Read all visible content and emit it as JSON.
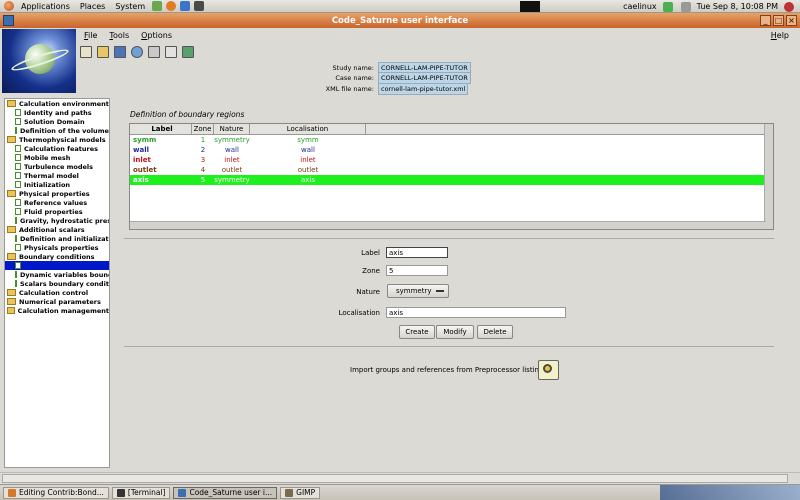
{
  "desktop": {
    "menus": [
      "Applications",
      "Places",
      "System"
    ],
    "user": "caelinux",
    "clock": "Tue Sep  8, 10:08 PM"
  },
  "window": {
    "title": "Code_Saturne user interface",
    "menus": [
      "File",
      "Tools",
      "Options"
    ],
    "help": "Help"
  },
  "study": {
    "study_label": "Study name:",
    "study_value": "CORNELL-LAM-PIPE-TUTOR",
    "case_label": "Case name:",
    "case_value": "CORNELL-LAM-PIPE-TUTOR",
    "xml_label": "XML file name:",
    "xml_value": "cornell-lam-pipe-tutor.xml"
  },
  "tree": [
    {
      "label": "Calculation environment",
      "level": 0,
      "type": "folder"
    },
    {
      "label": "Identity and paths",
      "level": 1,
      "type": "doc"
    },
    {
      "label": "Solution Domain",
      "level": 1,
      "type": "doc"
    },
    {
      "label": "Definition of the volume zones",
      "level": 1,
      "type": "doc"
    },
    {
      "label": "Thermophysical models",
      "level": 0,
      "type": "folder"
    },
    {
      "label": "Calculation features",
      "level": 1,
      "type": "doc"
    },
    {
      "label": "Mobile mesh",
      "level": 1,
      "type": "doc"
    },
    {
      "label": "Turbulence models",
      "level": 1,
      "type": "doc"
    },
    {
      "label": "Thermal model",
      "level": 1,
      "type": "doc"
    },
    {
      "label": "Initialization",
      "level": 1,
      "type": "doc"
    },
    {
      "label": "Physical properties",
      "level": 0,
      "type": "folder"
    },
    {
      "label": "Reference values",
      "level": 1,
      "type": "doc"
    },
    {
      "label": "Fluid properties",
      "level": 1,
      "type": "doc"
    },
    {
      "label": "Gravity, hydrostatic pressure",
      "level": 1,
      "type": "doc"
    },
    {
      "label": "Additional scalars",
      "level": 0,
      "type": "folder"
    },
    {
      "label": "Definition and initialization",
      "level": 1,
      "type": "doc"
    },
    {
      "label": "Physicals properties",
      "level": 1,
      "type": "doc"
    },
    {
      "label": "Boundary conditions",
      "level": 0,
      "type": "folder"
    },
    {
      "label": "",
      "level": 1,
      "type": "doc",
      "selected": true
    },
    {
      "label": "Dynamic variables bound. cond.",
      "level": 1,
      "type": "doc"
    },
    {
      "label": "Scalars boundary conditions",
      "level": 1,
      "type": "doc"
    },
    {
      "label": "Calculation control",
      "level": 0,
      "type": "folder"
    },
    {
      "label": "Numerical parameters",
      "level": 0,
      "type": "folder"
    },
    {
      "label": "Calculation management",
      "level": 0,
      "type": "folder"
    }
  ],
  "boundary": {
    "section_title": "Definition of boundary regions",
    "headers": [
      "Label",
      "Zone",
      "Nature",
      "Localisation"
    ],
    "rows": [
      {
        "label": "symm",
        "zone": "1",
        "nature": "symmetry",
        "loc": "symm",
        "color": "#2aa02a"
      },
      {
        "label": "wall",
        "zone": "2",
        "nature": "wall",
        "loc": "wall",
        "color": "#1f2a9a"
      },
      {
        "label": "inlet",
        "zone": "3",
        "nature": "inlet",
        "loc": "inlet",
        "color": "#c01414"
      },
      {
        "label": "outlet",
        "zone": "4",
        "nature": "outlet",
        "loc": "outlet",
        "color": "#7a3a10"
      },
      {
        "label": "axis",
        "zone": "5",
        "nature": "symmetry",
        "loc": "axis",
        "color": "#ffffff",
        "selected": true
      }
    ]
  },
  "form": {
    "label_caption": "Label",
    "label_value": "axis",
    "zone_caption": "Zone",
    "zone_value": "5",
    "nature_caption": "Nature",
    "nature_value": "symmetry",
    "loc_caption": "Localisation",
    "loc_value": "axis",
    "create": "Create",
    "modify": "Modify",
    "delete": "Delete",
    "import_text": "Import groups and references from Preprocessor listing"
  },
  "taskbar": [
    {
      "label": "Editing Contrib:Bond...",
      "icon_color": "#d8772a"
    },
    {
      "label": "[Terminal]",
      "icon_color": "#333333"
    },
    {
      "label": "Code_Saturne user i...",
      "icon_color": "#3a6fb3",
      "active": true
    },
    {
      "label": "GIMP",
      "icon_color": "#7a6a50"
    }
  ],
  "colors": {
    "title_bar": "#d9803f",
    "selection_green": "#1df01d",
    "tree_selection": "#0018c8"
  }
}
